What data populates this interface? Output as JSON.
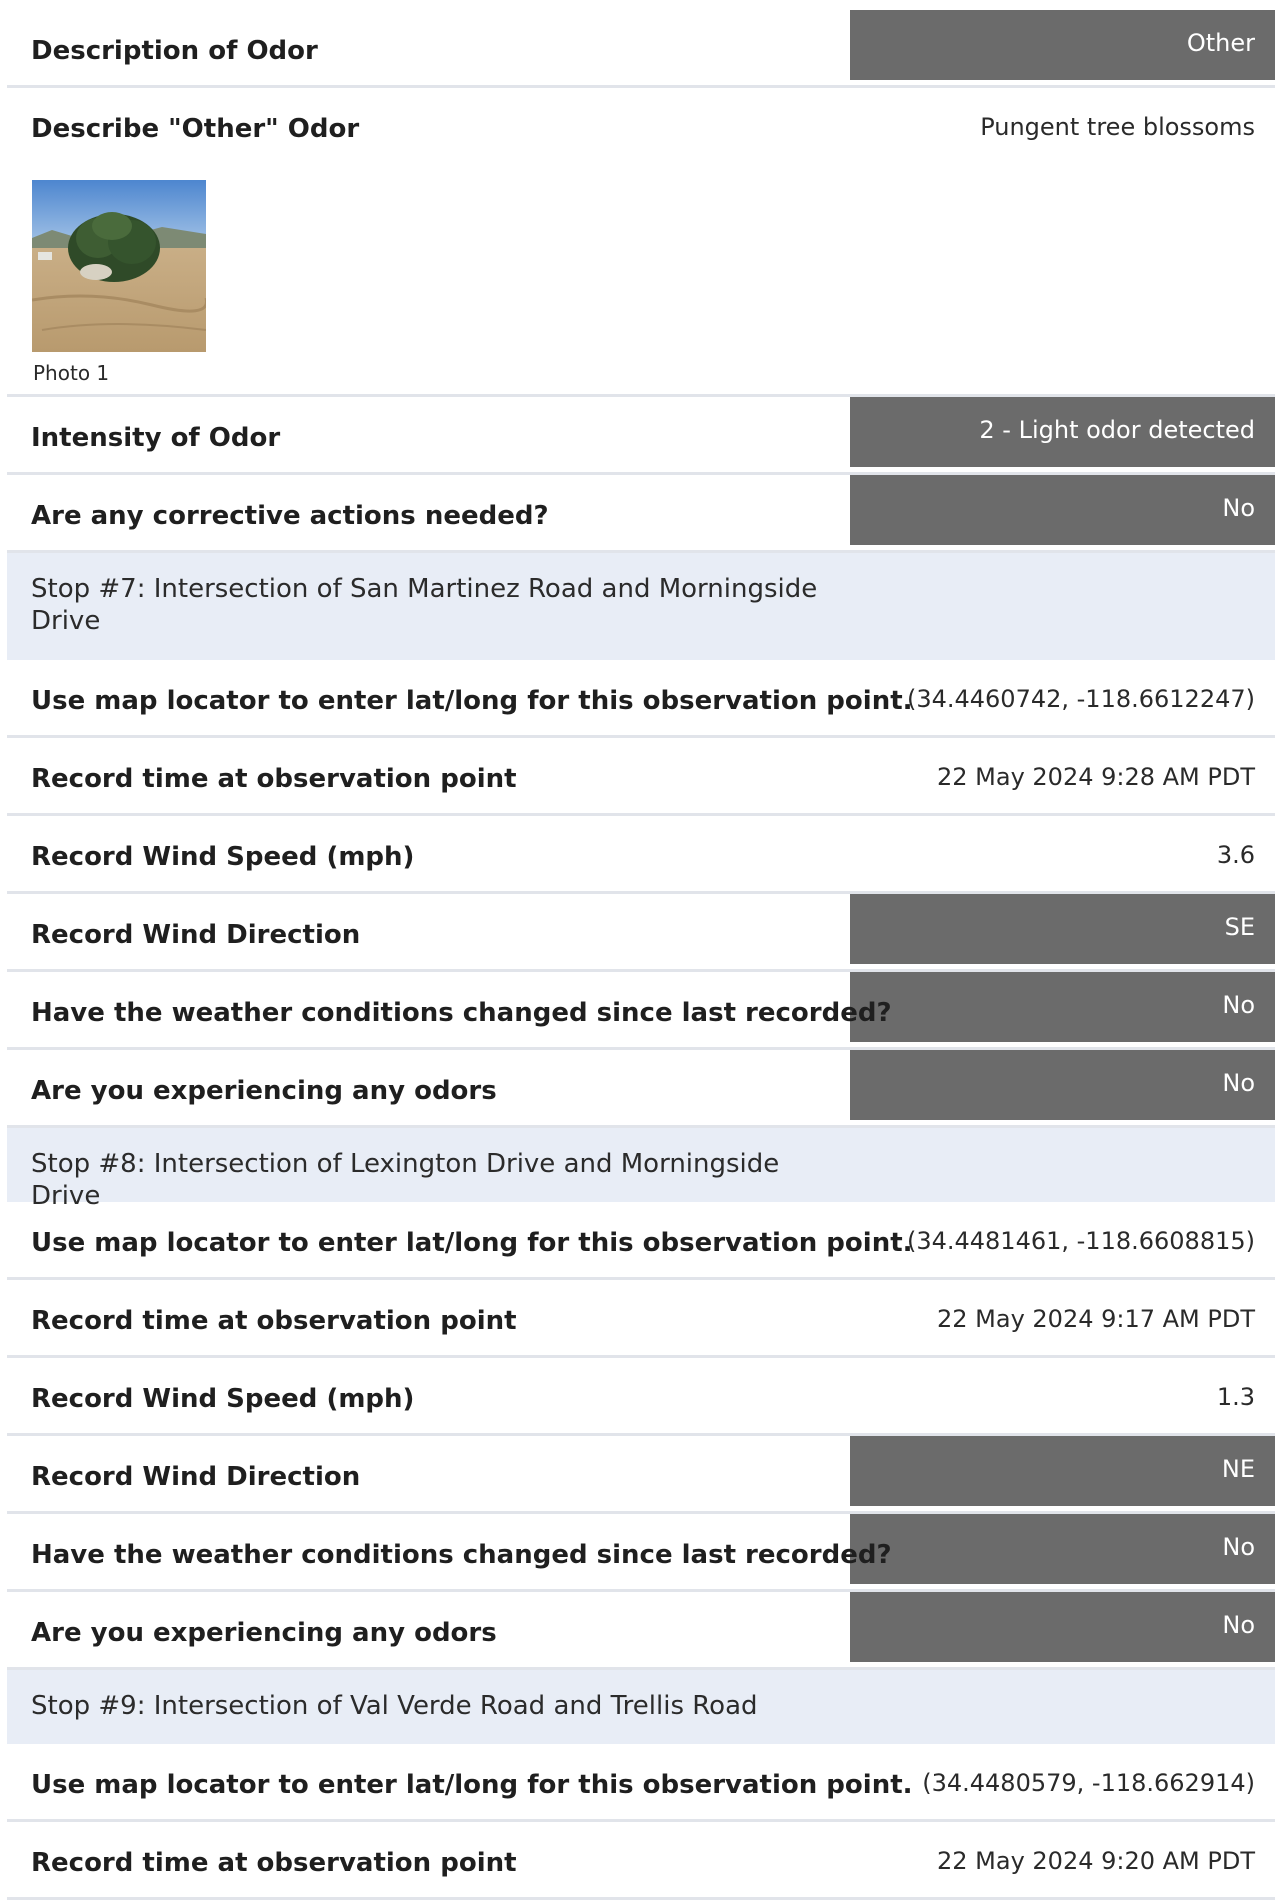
{
  "rows": [
    {
      "type": "choice",
      "label": "Description of Odor",
      "value": "Other"
    },
    {
      "type": "text",
      "label": "Describe \"Other\" Odor",
      "value": "Pungent tree blossoms",
      "photo_caption": "Photo 1"
    },
    {
      "type": "choice",
      "label": "Intensity of Odor",
      "value": "2 - Light odor detected"
    },
    {
      "type": "choice",
      "label": "Are any corrective actions needed?",
      "value": "No"
    },
    {
      "type": "section",
      "title": "Stop #7: Intersection of San Martinez Road and Morningside Drive"
    },
    {
      "type": "text",
      "label": "Use map locator to enter lat/long for this observation point.",
      "value": "(34.4460742, -118.6612247)"
    },
    {
      "type": "text",
      "label": "Record time at observation point",
      "value": "22 May 2024 9:28 AM PDT"
    },
    {
      "type": "text",
      "label": "Record Wind Speed (mph)",
      "value": "3.6"
    },
    {
      "type": "choice",
      "label": "Record Wind Direction",
      "value": "SE"
    },
    {
      "type": "choice",
      "label": "Have the weather conditions changed since last recorded?",
      "value": "No"
    },
    {
      "type": "choice",
      "label": "Are you experiencing any odors",
      "value": "No"
    },
    {
      "type": "section",
      "title": "Stop #8: Intersection of Lexington Drive and Morningside Drive"
    },
    {
      "type": "text",
      "label": "Use map locator to enter lat/long for this observation point.",
      "value": "(34.4481461, -118.6608815)"
    },
    {
      "type": "text",
      "label": "Record time at observation point",
      "value": "22 May 2024 9:17 AM PDT"
    },
    {
      "type": "text",
      "label": "Record Wind Speed (mph)",
      "value": "1.3"
    },
    {
      "type": "choice",
      "label": "Record Wind Direction",
      "value": "NE"
    },
    {
      "type": "choice",
      "label": "Have the weather conditions changed since last recorded?",
      "value": "No"
    },
    {
      "type": "choice",
      "label": "Are you experiencing any odors",
      "value": "No"
    },
    {
      "type": "section",
      "title": "Stop #9: Intersection of Val Verde Road and Trellis Road"
    },
    {
      "type": "text",
      "label": "Use map locator to enter lat/long for this observation point.",
      "value": "(34.4480579, -118.662914)"
    },
    {
      "type": "text",
      "label": "Record time at observation point",
      "value": "22 May 2024 9:20 AM PDT"
    }
  ],
  "colors": {
    "choice_box": "#6b6b6b",
    "section_bg": "#e8edf6",
    "divider": "#e1e4ea"
  }
}
